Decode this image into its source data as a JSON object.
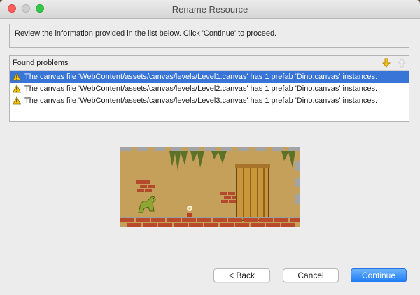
{
  "window": {
    "title": "Rename Resource"
  },
  "info": {
    "text": "Review the information provided in the list below. Click 'Continue' to proceed."
  },
  "problems": {
    "header": "Found problems",
    "items": [
      {
        "text": "The canvas file 'WebContent/assets/canvas/levels/Level1.canvas' has 1 prefab 'Dino.canvas' instances.",
        "selected": true,
        "icon": "warning-icon"
      },
      {
        "text": "The canvas file 'WebContent/assets/canvas/levels/Level2.canvas' has 1 prefab 'Dino.canvas' instances.",
        "selected": false,
        "icon": "warning-icon"
      },
      {
        "text": "The canvas file 'WebContent/assets/canvas/levels/Level3.canvas' has 1 prefab 'Dino.canvas' instances.",
        "selected": false,
        "icon": "warning-icon"
      }
    ],
    "toolbar": [
      "next-problem-icon",
      "previous-problem-icon"
    ]
  },
  "buttons": {
    "back": "< Back",
    "cancel": "Cancel",
    "continue": "Continue"
  },
  "colors": {
    "selection": "#3875d7",
    "primary_button": "#1e7cf7",
    "warning": "#f5c400"
  }
}
